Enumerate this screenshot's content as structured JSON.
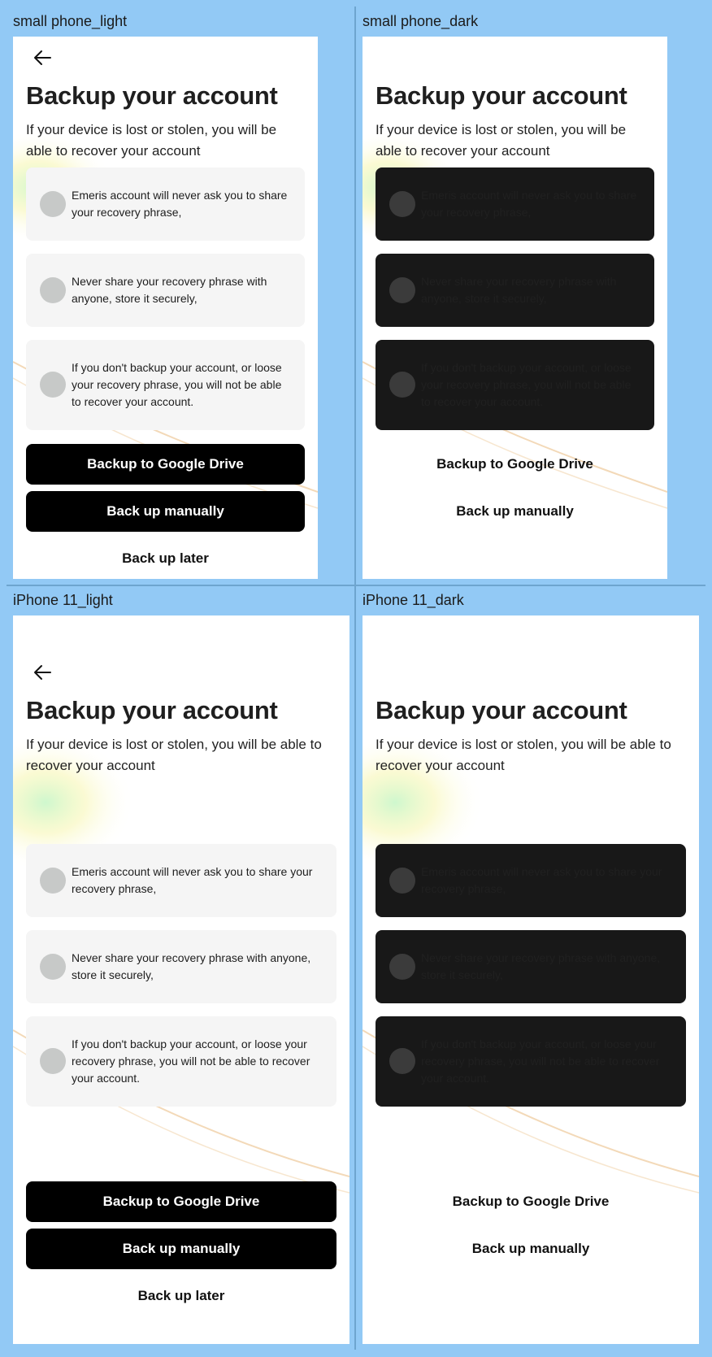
{
  "frames": {
    "small_light": {
      "label": "small phone_light"
    },
    "small_dark": {
      "label": "small phone_dark"
    },
    "iphone_light": {
      "label": "iPhone 11_light"
    },
    "iphone_dark": {
      "label": "iPhone 11_dark"
    }
  },
  "screen": {
    "title": "Backup your account",
    "subtitle": "If your device is lost or stolen, you will be able to recover your account",
    "cards": [
      "Emeris account will never ask you to share your recovery phrase,",
      "Never share your recovery phrase with anyone, store it securely,",
      "If you don't backup your account, or loose your recovery phrase, you will not be able to recover your account."
    ],
    "google_drive_label": "Backup to Google Drive",
    "manual_label": "Back up manually",
    "later_label": "Back up later"
  },
  "icons": {
    "back": "arrow-left-icon"
  },
  "colors": {
    "canvas": "#92c9f5",
    "primary_button": "#000000",
    "light_card": "#f5f5f5",
    "dark_card": "#181818"
  }
}
